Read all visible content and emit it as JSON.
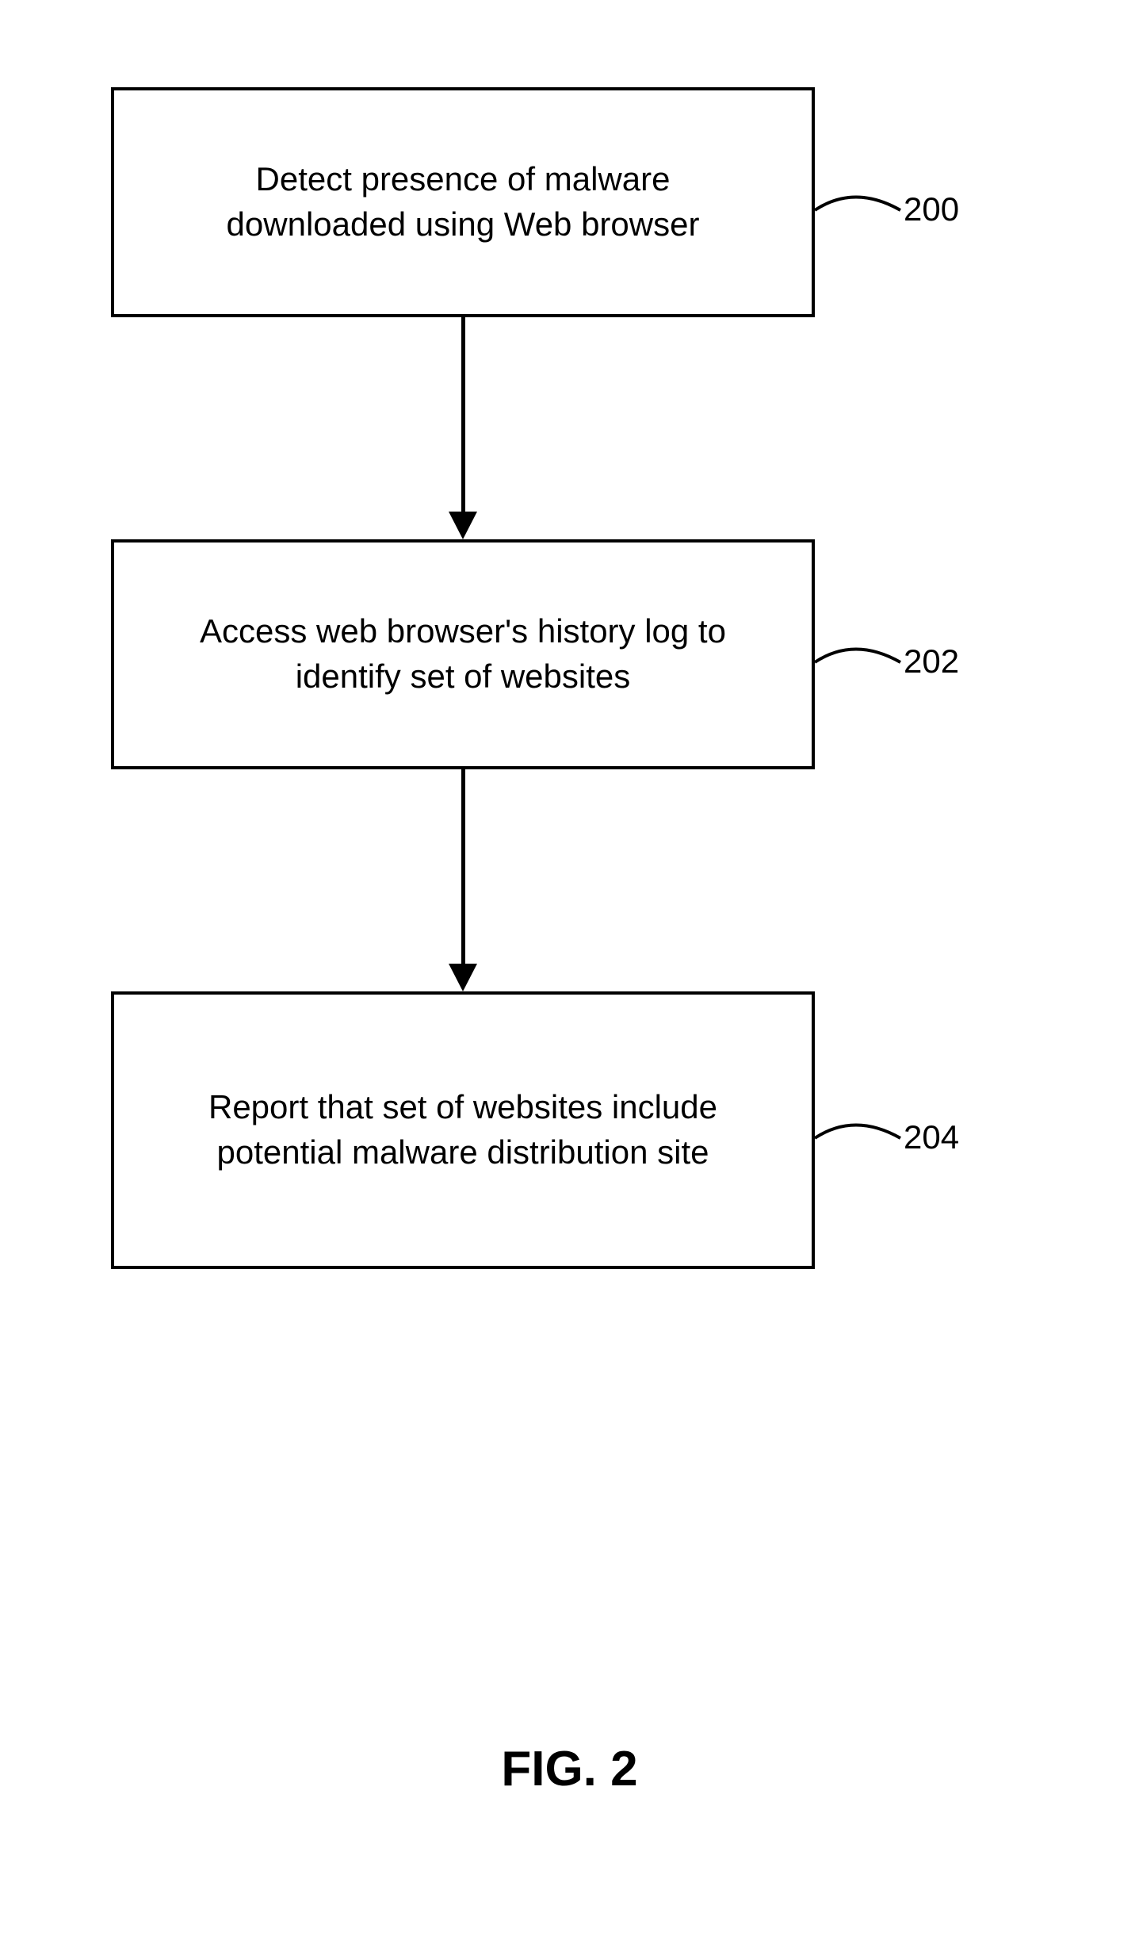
{
  "flowchart": {
    "boxes": [
      {
        "text": "Detect presence of malware downloaded using Web browser",
        "ref": "200"
      },
      {
        "text": "Access web browser's history log to identify set of websites",
        "ref": "202"
      },
      {
        "text": "Report that set of websites include potential malware distribution site",
        "ref": "204"
      }
    ],
    "figure_title": "FIG. 2"
  }
}
